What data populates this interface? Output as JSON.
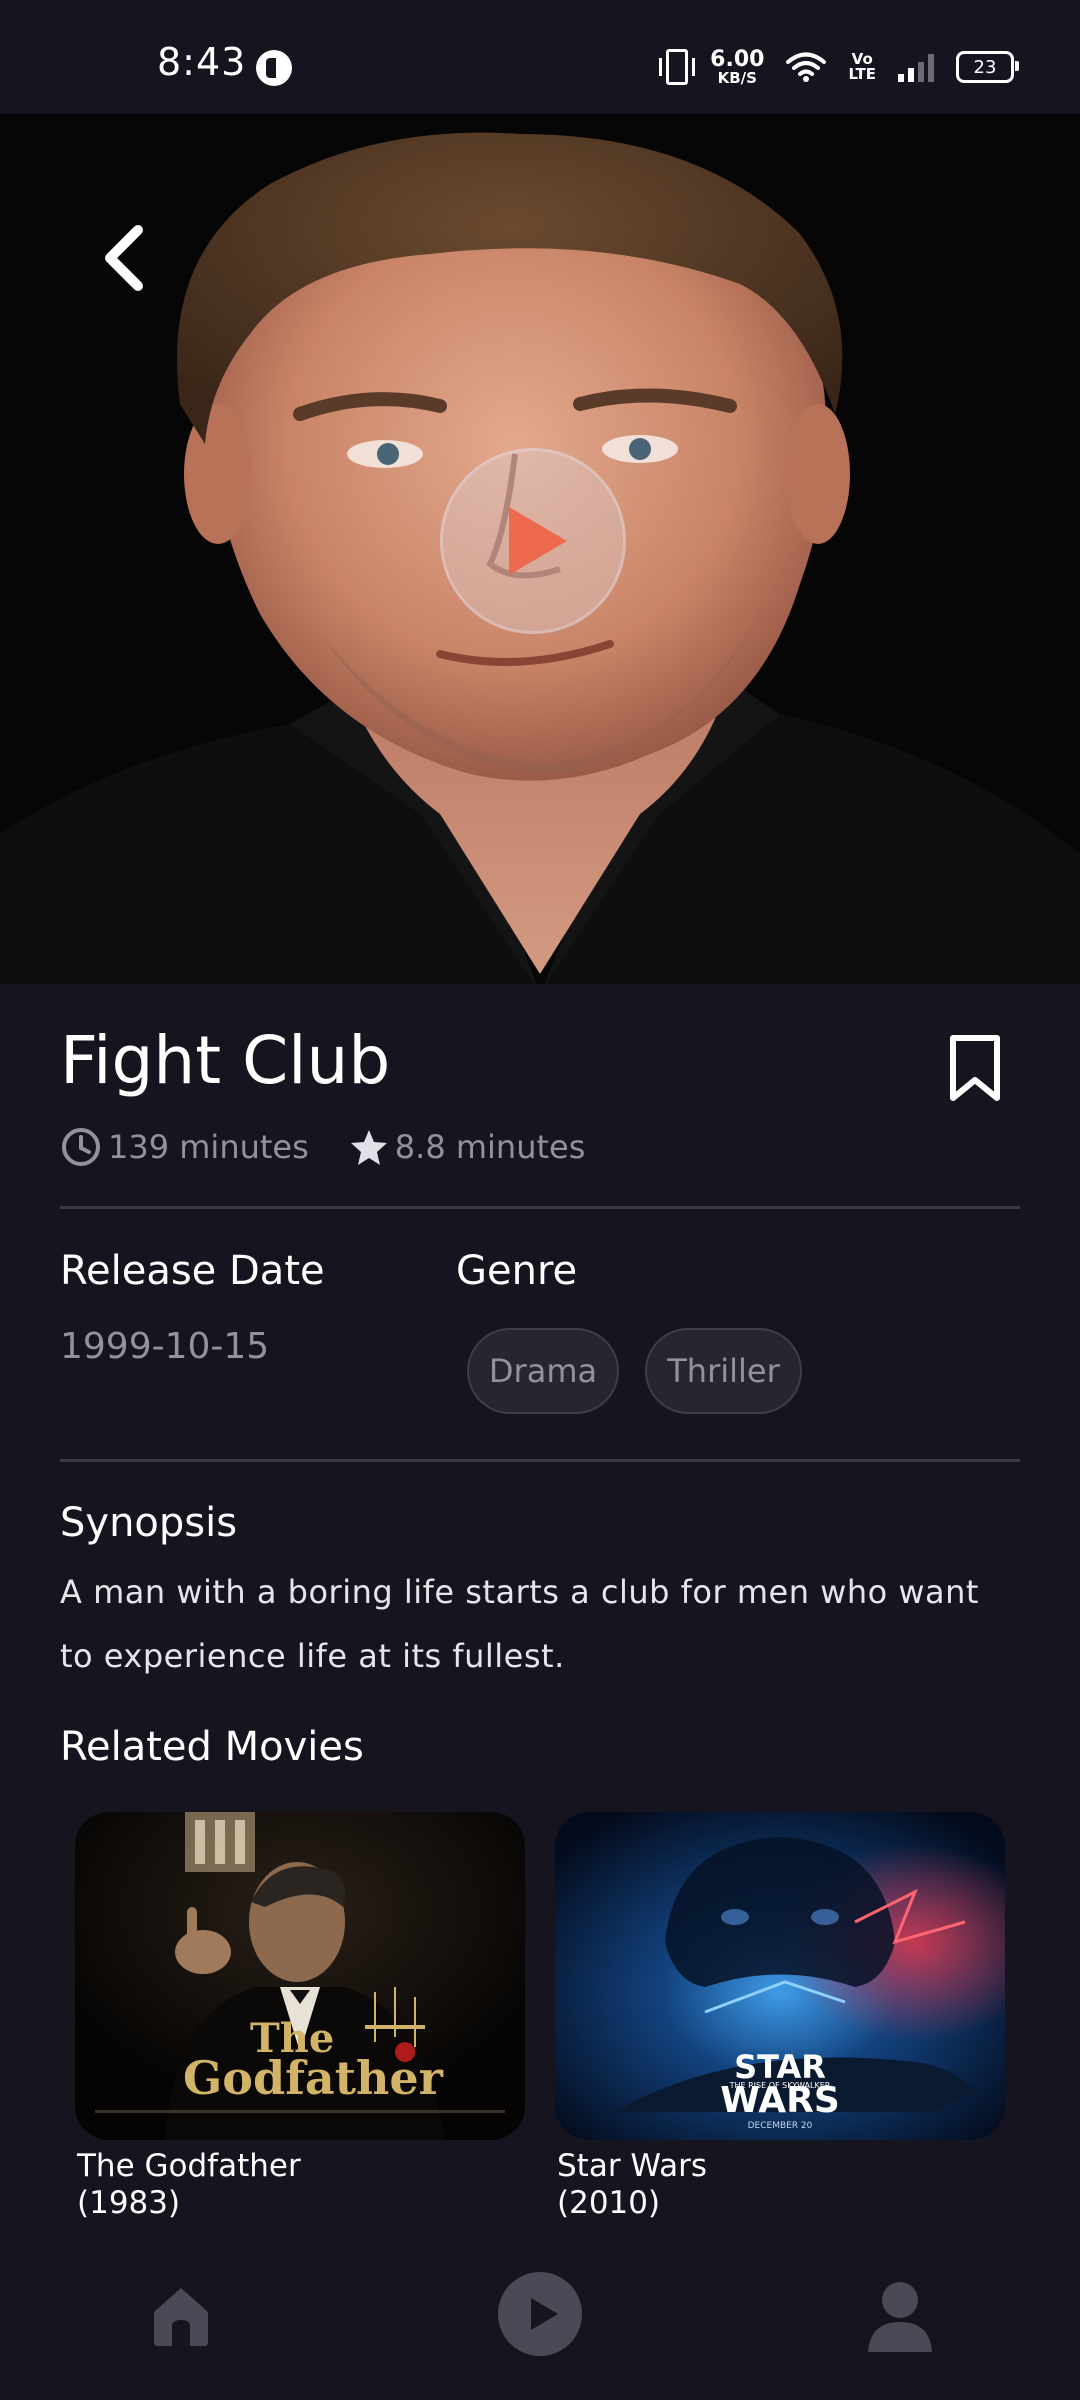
{
  "status_bar": {
    "time": "8:43",
    "net_speed_value": "6.00",
    "net_speed_unit": "KB/S",
    "volte_top": "Vo",
    "volte_bottom": "LTE",
    "battery": "23"
  },
  "movie": {
    "title": "Fight Club",
    "duration": "139 minutes",
    "rating": "8.8 minutes",
    "release_label": "Release Date",
    "release_date": "1999-10-15",
    "genre_label": "Genre",
    "genres": [
      "Drama",
      "Thriller"
    ],
    "synopsis_label": "Synopsis",
    "synopsis": "A man with a boring life starts a club for men who want to experience life at its fullest."
  },
  "related": {
    "label": "Related Movies",
    "items": [
      {
        "title": "The Godfather",
        "year": "(1983)",
        "poster_text_1": "The",
        "poster_text_2": "Godfather"
      },
      {
        "title": "Star Wars",
        "year": "(2010)",
        "poster_text_1": "STAR",
        "poster_text_2": "WARS",
        "poster_text_small": "THE RISE OF SKYWALKER",
        "poster_text_date": "DECEMBER 20"
      }
    ]
  },
  "colors": {
    "background": "#15141f",
    "accent": "#ee6a4e",
    "muted_text": "#92929d",
    "chip_bg": "#262530"
  },
  "icons": [
    "back-icon",
    "play-icon",
    "bookmark-icon",
    "clock-icon",
    "star-icon",
    "home-icon",
    "play-circle-icon",
    "profile-icon"
  ]
}
